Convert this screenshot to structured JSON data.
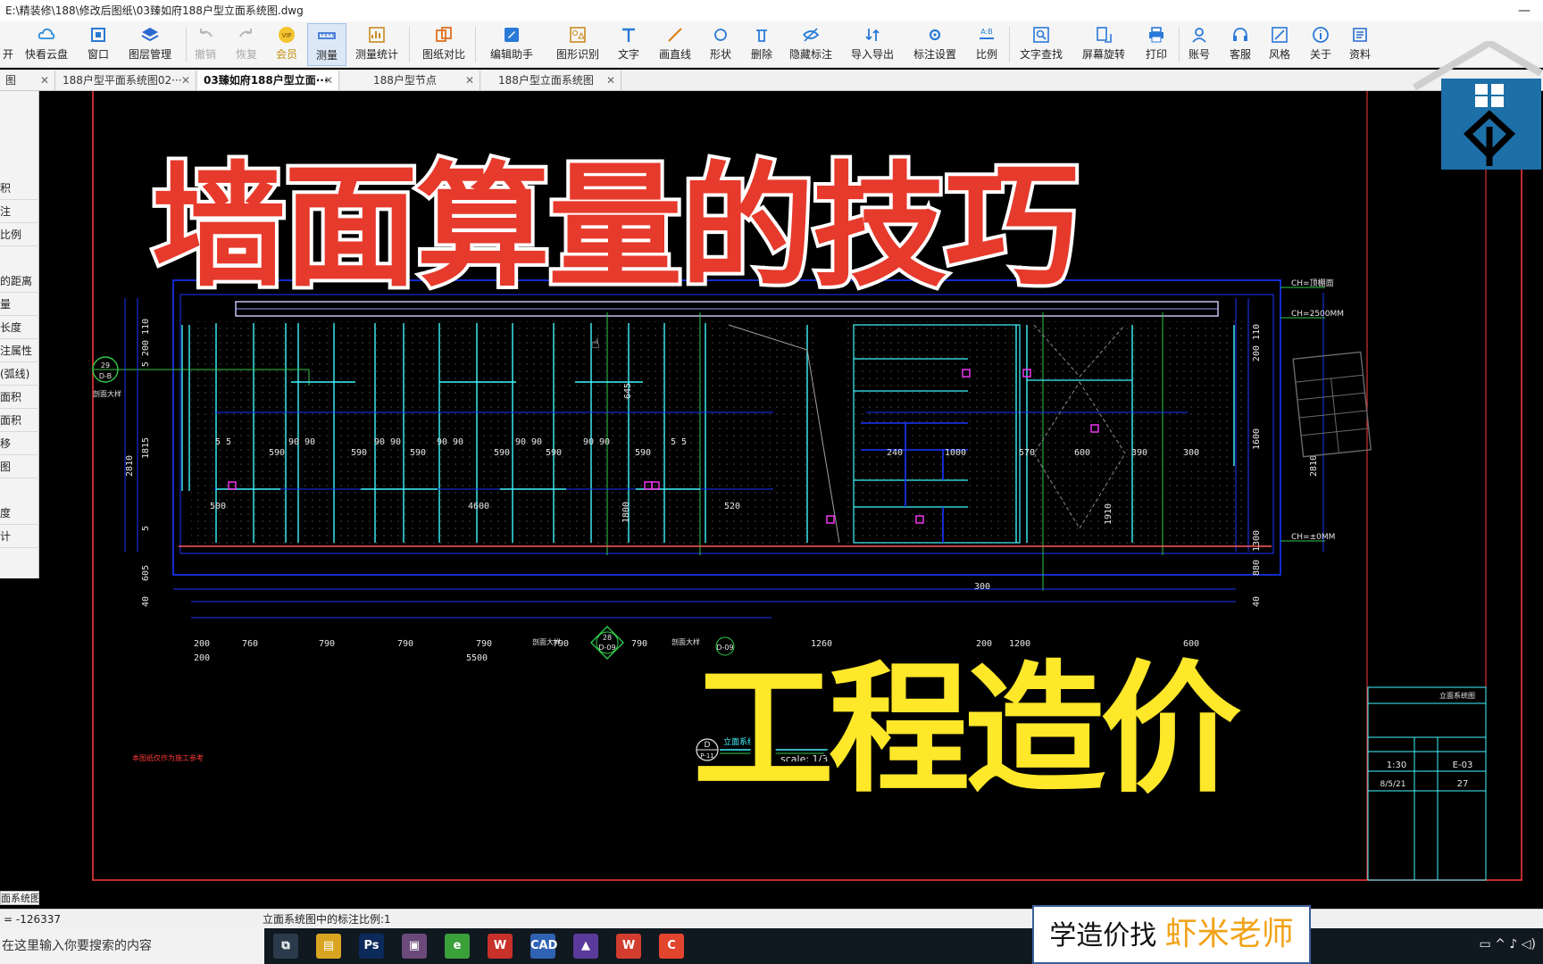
{
  "window": {
    "title": "E:\\精装修\\188\\修改后图纸\\03臻如府188户型立面系统图.dwg",
    "minimize_glyph": "—"
  },
  "toolbar": {
    "items": [
      {
        "label": "开",
        "icon": "open-icon"
      },
      {
        "label": "快看云盘",
        "icon": "cloud-icon"
      },
      {
        "label": "窗口",
        "icon": "window-icon"
      },
      {
        "label": "图层管理",
        "icon": "layers-icon"
      },
      {
        "label": "撤销",
        "icon": "undo-icon"
      },
      {
        "label": "恢复",
        "icon": "redo-icon"
      },
      {
        "label": "会员",
        "icon": "vip-icon"
      },
      {
        "label": "测量",
        "icon": "measure-icon"
      },
      {
        "label": "测量统计",
        "icon": "measure-stats-icon"
      },
      {
        "label": "图纸对比",
        "icon": "compare-icon"
      },
      {
        "label": "编辑助手",
        "icon": "edit-assistant-icon"
      },
      {
        "label": "图形识别",
        "icon": "shape-recognize-icon"
      },
      {
        "label": "文字",
        "icon": "text-icon"
      },
      {
        "label": "画直线",
        "icon": "line-icon"
      },
      {
        "label": "形状",
        "icon": "shape-icon"
      },
      {
        "label": "删除",
        "icon": "delete-icon"
      },
      {
        "label": "隐藏标注",
        "icon": "hide-annotation-icon"
      },
      {
        "label": "导入导出",
        "icon": "import-export-icon"
      },
      {
        "label": "标注设置",
        "icon": "annotation-settings-icon"
      },
      {
        "label": "比例",
        "icon": "scale-icon"
      },
      {
        "label": "文字查找",
        "icon": "text-search-icon"
      },
      {
        "label": "屏幕旋转",
        "icon": "screen-rotate-icon"
      },
      {
        "label": "打印",
        "icon": "print-icon"
      },
      {
        "label": "账号",
        "icon": "account-icon"
      },
      {
        "label": "客服",
        "icon": "support-icon"
      },
      {
        "label": "风格",
        "icon": "style-icon"
      },
      {
        "label": "关于",
        "icon": "about-icon"
      },
      {
        "label": "资料",
        "icon": "materials-icon"
      }
    ]
  },
  "tabs": [
    {
      "label": "图",
      "close": "✕"
    },
    {
      "label": "188户型平面系统图02···",
      "close": "✕"
    },
    {
      "label": "03臻如府188户型立面···",
      "close": "✕"
    },
    {
      "label": "188户型节点",
      "close": "✕"
    },
    {
      "label": "188户型立面系统图",
      "close": "✕"
    }
  ],
  "side_panel": [
    "积",
    "注",
    "比例",
    "的距离",
    "量",
    "长度",
    "注属性",
    "(弧线)",
    "面积",
    "面积",
    "移",
    "图",
    "度",
    "计"
  ],
  "overlay": {
    "title_top": "墙面算量的技巧",
    "title_bottom": "工程造价"
  },
  "drawing": {
    "dims_top": [
      "590",
      "590",
      "590",
      "590",
      "590",
      "590"
    ],
    "dims_top_small": [
      "5 5",
      "90 90",
      "90 90",
      "90 90",
      "90 90",
      "90 90",
      "5 5"
    ],
    "dims_right": [
      "1000",
      "570",
      "600",
      "390",
      "300",
      "240"
    ],
    "dims_bottom_row1": [
      "200",
      "760",
      "790",
      "790",
      "790",
      "790",
      "790",
      "1260",
      "200",
      "1200",
      "600"
    ],
    "dims_bottom_row2": [
      "200",
      "5500"
    ],
    "dims_mid": [
      "4600",
      "1800",
      "520",
      "500",
      "645"
    ],
    "dims_vertical_left": [
      "5 200 110",
      "1815",
      "5",
      "605",
      "40"
    ],
    "dims_vertical_left_total": "2810",
    "dims_vertical_right": [
      "200 110",
      "1600",
      "1300",
      "880",
      "40"
    ],
    "dims_vertical_right_total": "2810",
    "ch_labels": [
      "CH=顶棚面",
      "CH=2500MM",
      "CH=±0MM"
    ],
    "labels_misc": [
      "1910",
      "300"
    ],
    "section_marks": [
      {
        "top": "29",
        "bottom": "D-B"
      },
      {
        "top": "28",
        "bottom": "D-09"
      },
      {
        "top": "",
        "bottom": "D-09"
      }
    ],
    "section_captions": [
      "剖面大样",
      "剖面大样",
      "剖面大样"
    ],
    "elev_label": "D",
    "elev_sub": "P-11",
    "elev_title": "立面系统图",
    "scale_text": "scale: 1/35",
    "note_red": "本图纸仅作为施工参考",
    "titleblock": {
      "scale": "1:30",
      "date": "8/5/21",
      "sheet": "E-03",
      "page": "27",
      "name": "立面系统图"
    }
  },
  "model_tab": "面系统图",
  "status": {
    "coord": "= -126337",
    "message": "立面系统图中的标注比例:1"
  },
  "taskbar": {
    "search_text": "在这里输入你要搜索的内容",
    "apps": [
      {
        "label": "⧉",
        "color": "#2b3a4a"
      },
      {
        "label": "▤",
        "color": "#d9a520"
      },
      {
        "label": "Ps",
        "color": "#0b2a5a"
      },
      {
        "label": "▣",
        "color": "#6b4a7a"
      },
      {
        "label": "e",
        "color": "#3aa03a"
      },
      {
        "label": "W",
        "color": "#c8302a"
      },
      {
        "label": "CAD",
        "color": "#2f62b2"
      },
      {
        "label": "▲",
        "color": "#5a3a9a"
      },
      {
        "label": "W",
        "color": "#d23d2d"
      },
      {
        "label": "C",
        "color": "#e2452e"
      }
    ],
    "tray_text": "▭  ^  ♪  ◁)"
  },
  "promo": {
    "prefix": "学造价找 ",
    "name": "虾米老师"
  },
  "colors": {
    "title_red": "#e63a2c",
    "title_yellow": "#ffe82a",
    "cad_blue": "#1a36ff",
    "cad_cyan": "#3ff6ff",
    "cad_green": "#2fc94a"
  }
}
